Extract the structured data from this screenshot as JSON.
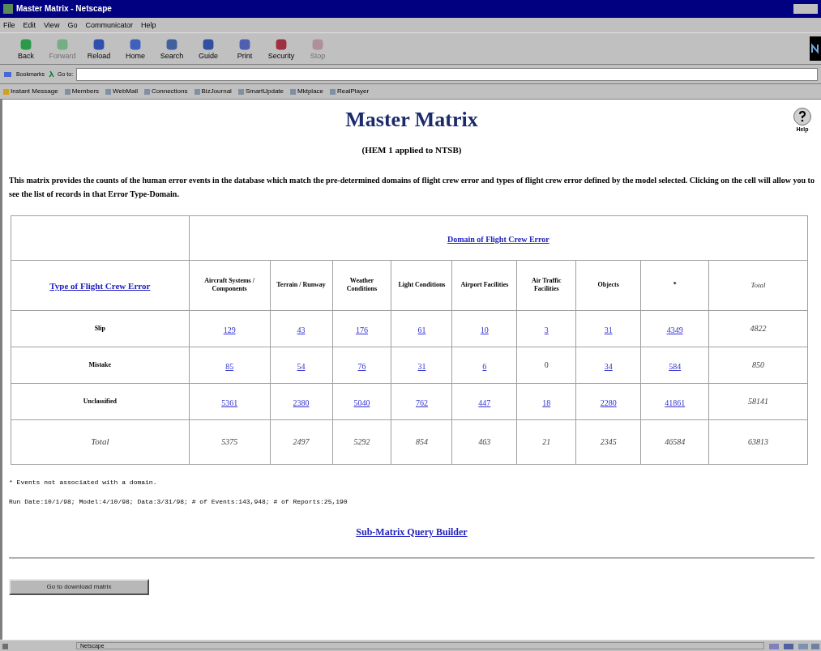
{
  "window": {
    "title": "Master Matrix - Netscape"
  },
  "menu": [
    "File",
    "Edit",
    "View",
    "Go",
    "Communicator",
    "Help"
  ],
  "toolbar": [
    {
      "label": "Back",
      "disabled": false
    },
    {
      "label": "Forward",
      "disabled": true
    },
    {
      "label": "Reload",
      "disabled": false
    },
    {
      "label": "Home",
      "disabled": false
    },
    {
      "label": "Search",
      "disabled": false
    },
    {
      "label": "Guide",
      "disabled": false
    },
    {
      "label": "Print",
      "disabled": false
    },
    {
      "label": "Security",
      "disabled": false
    },
    {
      "label": "Stop",
      "disabled": true
    }
  ],
  "location_bar": {
    "bookmarks": "Bookmarks",
    "goto": "Go to:"
  },
  "personal_toolbar": [
    "Instant Message",
    "Members",
    "WebMail",
    "Connections",
    "BizJournal",
    "SmartUpdate",
    "Mktplace",
    "RealPlayer"
  ],
  "page": {
    "title": "Master Matrix",
    "subtitle": "(HEM 1 applied to NTSB)",
    "help": "Help",
    "description": "This matrix provides the counts of the human error events in the database which match the pre-determined domains of flight crew error and types of flight crew error defined by the model selected. Clicking on the cell will allow you to see the list of records in that Error Type-Domain.",
    "table": {
      "domain_header": "Domain of Flight Crew Error",
      "type_header": "Type of Flight Crew Error",
      "columns": [
        {
          "label": "Aircraft Systems / Components",
          "kind": "domain"
        },
        {
          "label": "Terrain / Runway",
          "kind": "domain"
        },
        {
          "label": "Weather Conditions",
          "kind": "domain"
        },
        {
          "label": "Light Conditions",
          "kind": "domain"
        },
        {
          "label": "Airport Facilities",
          "kind": "domain"
        },
        {
          "label": "Air Traffic Facilities",
          "kind": "domain"
        },
        {
          "label": "Objects",
          "kind": "domain"
        },
        {
          "label": "*",
          "kind": "domain"
        },
        {
          "label": "Total",
          "kind": "total"
        }
      ],
      "rows": [
        {
          "label": "Slip",
          "kind": "data",
          "cells": [
            {
              "text": "129",
              "kind": "link"
            },
            {
              "text": "43",
              "kind": "link"
            },
            {
              "text": "176",
              "kind": "link"
            },
            {
              "text": "61",
              "kind": "link"
            },
            {
              "text": "10",
              "kind": "link"
            },
            {
              "text": "3",
              "kind": "link"
            },
            {
              "text": "31",
              "kind": "link"
            },
            {
              "text": "4349",
              "kind": "link"
            },
            {
              "text": "4822",
              "kind": "total"
            }
          ]
        },
        {
          "label": "Mistake",
          "kind": "data",
          "cells": [
            {
              "text": "85",
              "kind": "link"
            },
            {
              "text": "54",
              "kind": "link"
            },
            {
              "text": "76",
              "kind": "link"
            },
            {
              "text": "31",
              "kind": "link"
            },
            {
              "text": "6",
              "kind": "link"
            },
            {
              "text": "0",
              "kind": "plain"
            },
            {
              "text": "34",
              "kind": "link"
            },
            {
              "text": "584",
              "kind": "link"
            },
            {
              "text": "850",
              "kind": "total"
            }
          ]
        },
        {
          "label": "Unclassified",
          "kind": "data",
          "cells": [
            {
              "text": "5361",
              "kind": "link"
            },
            {
              "text": "2380",
              "kind": "link"
            },
            {
              "text": "5040",
              "kind": "link"
            },
            {
              "text": "762",
              "kind": "link"
            },
            {
              "text": "447",
              "kind": "link"
            },
            {
              "text": "18",
              "kind": "link"
            },
            {
              "text": "2280",
              "kind": "link"
            },
            {
              "text": "41861",
              "kind": "link"
            },
            {
              "text": "58141",
              "kind": "total"
            }
          ]
        },
        {
          "label": "Total",
          "kind": "total",
          "cells": [
            {
              "text": "5375",
              "kind": "total"
            },
            {
              "text": "2497",
              "kind": "total"
            },
            {
              "text": "5292",
              "kind": "total"
            },
            {
              "text": "854",
              "kind": "total"
            },
            {
              "text": "463",
              "kind": "total"
            },
            {
              "text": "21",
              "kind": "total"
            },
            {
              "text": "2345",
              "kind": "total"
            },
            {
              "text": "46584",
              "kind": "total"
            },
            {
              "text": "63813",
              "kind": "total"
            }
          ]
        }
      ]
    },
    "footnote": "* Events not associated with a domain.",
    "run_info": "Run Date:10/1/98; Model:4/10/98; Data:3/31/98; # of Events:143,948; # of Reports:25,190",
    "query_link": "Sub-Matrix Query Builder",
    "download_button": "Go to download matrix"
  },
  "status_bar": {
    "text": "Netscape"
  }
}
